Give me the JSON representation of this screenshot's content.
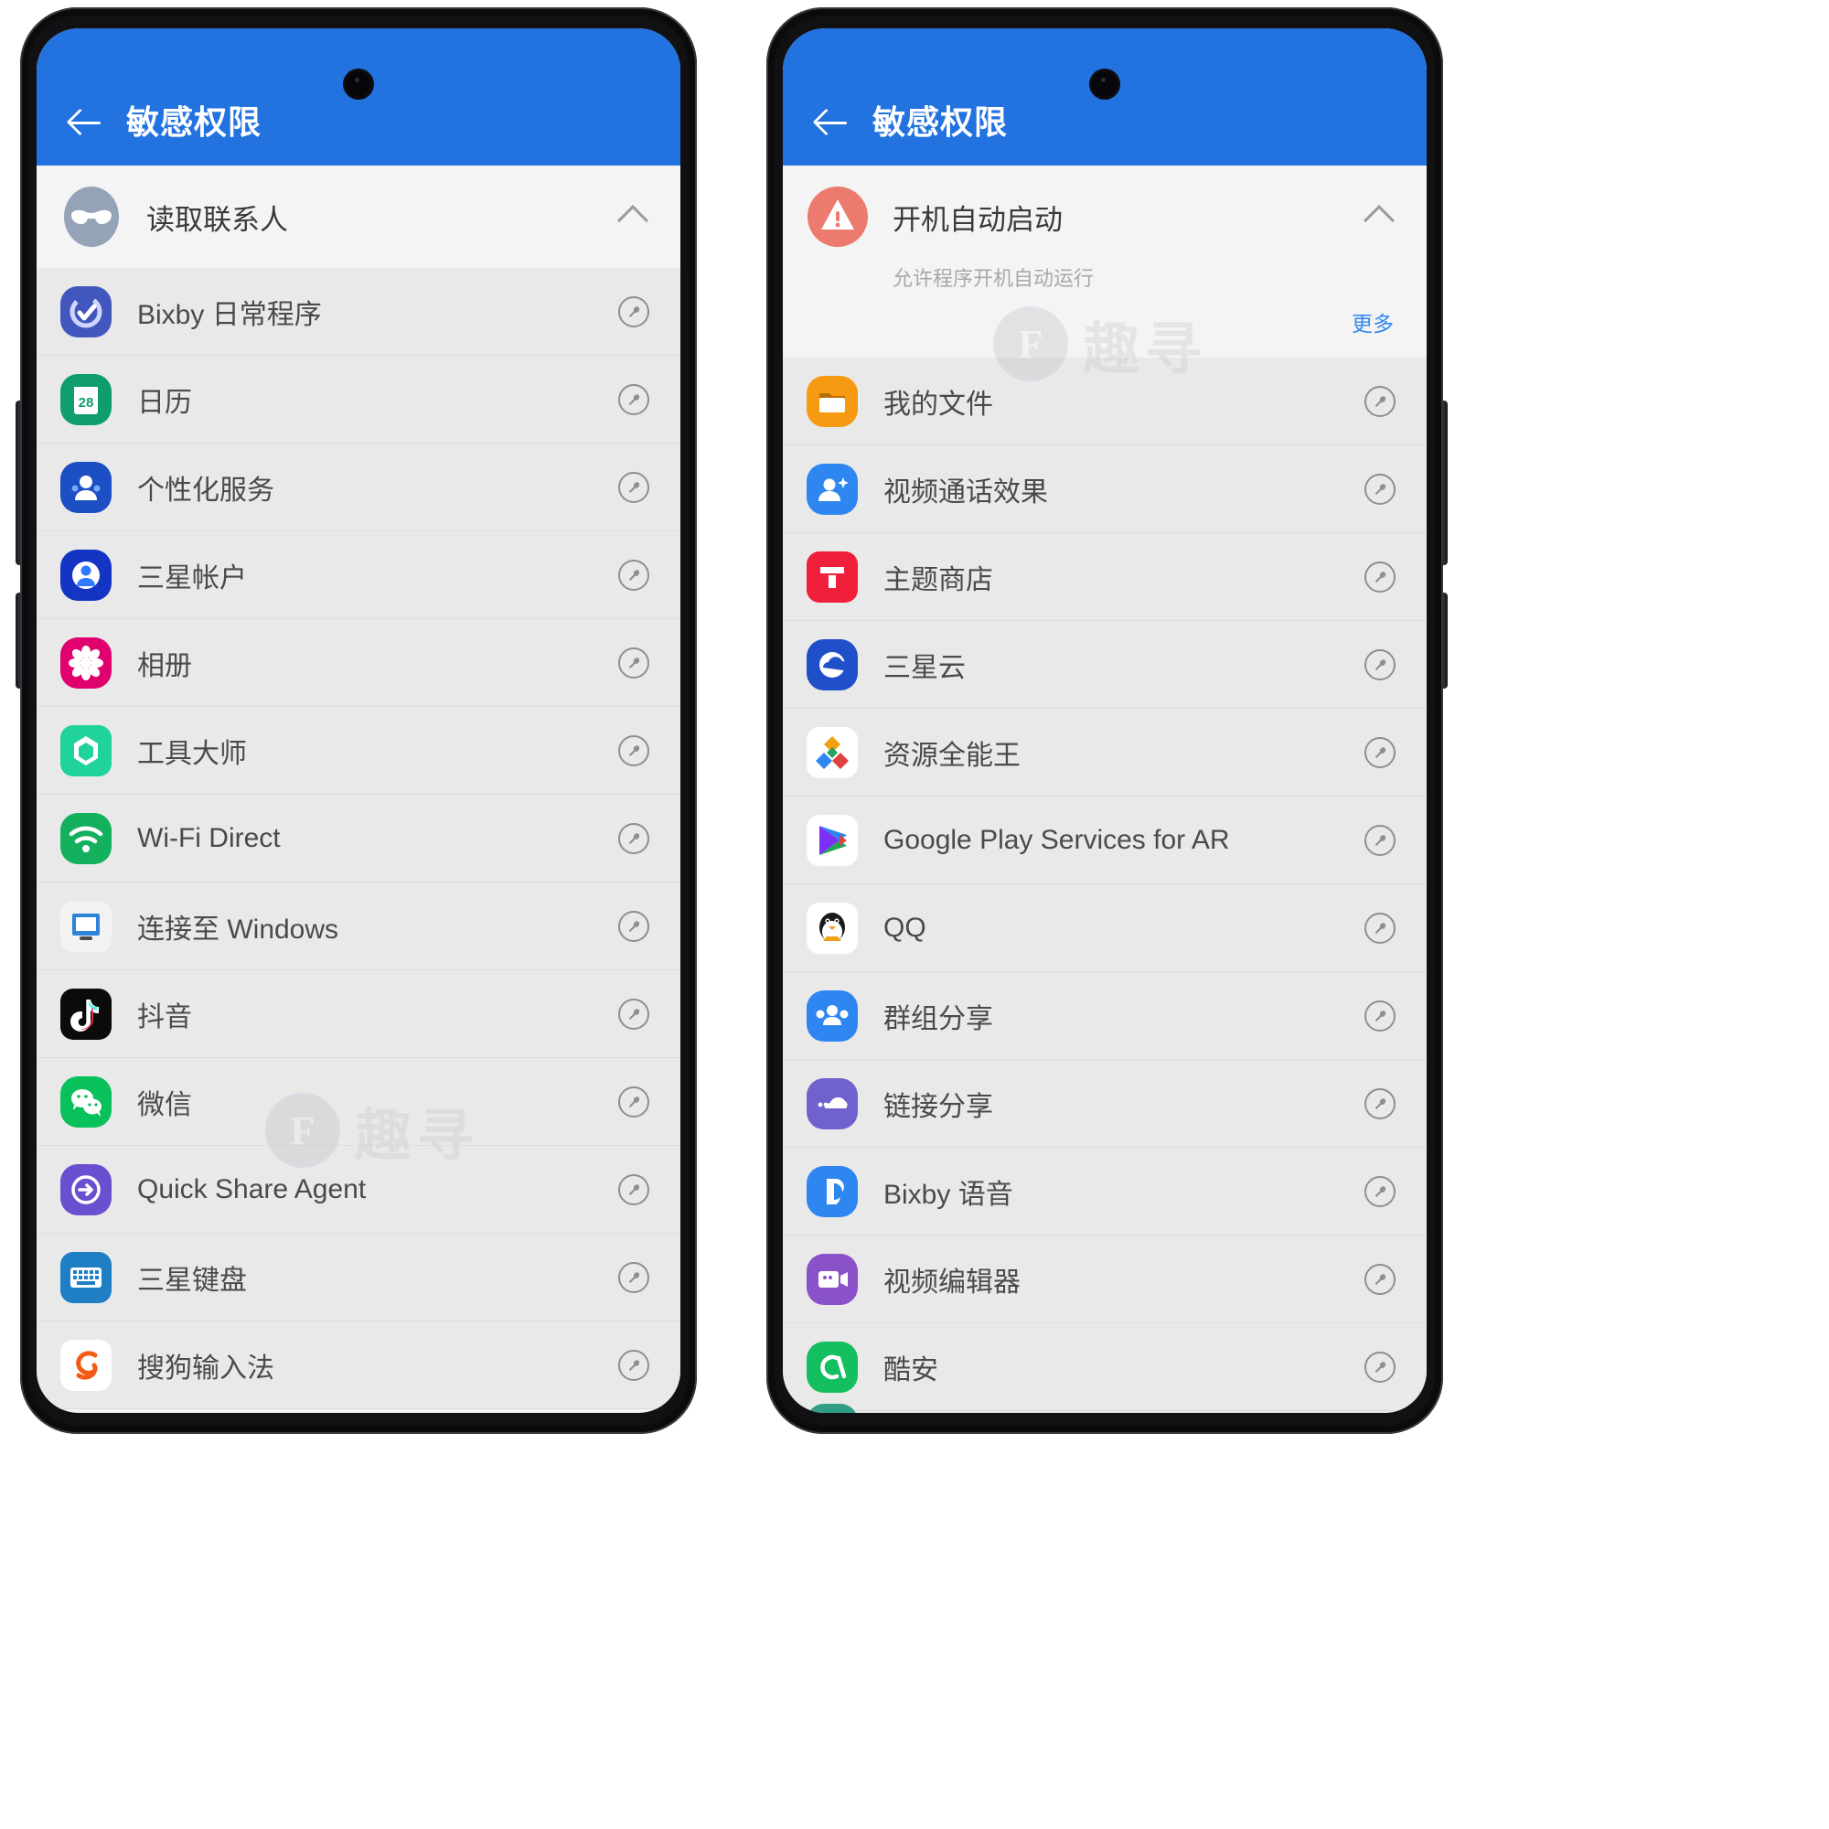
{
  "screens": [
    {
      "appbar": {
        "title": "敏感权限",
        "back_icon": "back-arrow-icon"
      },
      "group": {
        "icon": "mask-icon",
        "title": "读取联系人",
        "subtitle": "",
        "more_label": "",
        "collapse_icon": "chevron-up-icon"
      },
      "rows": [
        {
          "label": "Bixby 日常程序",
          "icon": "bixby-routines-icon"
        },
        {
          "label": "日历",
          "icon": "calendar-icon"
        },
        {
          "label": "个性化服务",
          "icon": "customization-service-icon"
        },
        {
          "label": "三星帐户",
          "icon": "samsung-account-icon"
        },
        {
          "label": "相册",
          "icon": "gallery-icon"
        },
        {
          "label": "工具大师",
          "icon": "tool-master-icon"
        },
        {
          "label": "Wi-Fi Direct",
          "icon": "wifi-direct-icon"
        },
        {
          "label": "连接至 Windows",
          "icon": "link-to-windows-icon"
        },
        {
          "label": "抖音",
          "icon": "douyin-icon"
        },
        {
          "label": "微信",
          "icon": "wechat-icon"
        },
        {
          "label": "Quick Share Agent",
          "icon": "quick-share-icon"
        },
        {
          "label": "三星键盘",
          "icon": "samsung-keyboard-icon"
        },
        {
          "label": "搜狗输入法",
          "icon": "sogou-input-icon"
        }
      ]
    },
    {
      "appbar": {
        "title": "敏感权限",
        "back_icon": "back-arrow-icon"
      },
      "group": {
        "icon": "warning-icon",
        "title": "开机自动启动",
        "subtitle": "允许程序开机自动运行",
        "more_label": "更多",
        "collapse_icon": "chevron-up-icon"
      },
      "rows": [
        {
          "label": "我的文件",
          "icon": "my-files-icon"
        },
        {
          "label": "视频通话效果",
          "icon": "video-call-effects-icon"
        },
        {
          "label": "主题商店",
          "icon": "theme-store-icon"
        },
        {
          "label": "三星云",
          "icon": "samsung-cloud-icon"
        },
        {
          "label": "资源全能王",
          "icon": "resource-master-icon"
        },
        {
          "label": "Google Play Services for AR",
          "icon": "play-services-ar-icon"
        },
        {
          "label": "QQ",
          "icon": "qq-icon"
        },
        {
          "label": "群组分享",
          "icon": "group-sharing-icon"
        },
        {
          "label": "链接分享",
          "icon": "link-sharing-icon"
        },
        {
          "label": "Bixby 语音",
          "icon": "bixby-voice-icon"
        },
        {
          "label": "视频编辑器",
          "icon": "video-editor-icon"
        },
        {
          "label": "酷安",
          "icon": "coolapk-icon"
        }
      ]
    }
  ],
  "watermark": {
    "logo_letter": "F",
    "text": "趣寻"
  },
  "colors": {
    "appbar": "#2272e0",
    "group_bg": "#f4f4f4",
    "row_bg": "#e9e9e9",
    "link": "#2f88f0",
    "label": "#4a4a4a"
  }
}
